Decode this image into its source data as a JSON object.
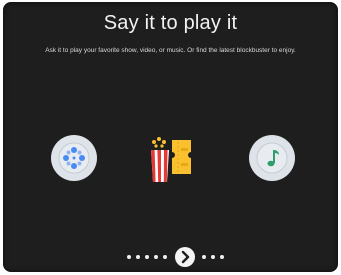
{
  "onboarding": {
    "title": "Say it to play it",
    "subtitle": "Ask it to play your favorite show, video, or music. Or find the latest blockbuster to enjoy."
  },
  "icons": [
    {
      "name": "film-reel-icon",
      "background": "#dde3e8",
      "accent": "#4a8af4"
    },
    {
      "name": "popcorn-ticket-icon",
      "accents": [
        "#e53935",
        "#fbc02d"
      ]
    },
    {
      "name": "music-note-icon",
      "background": "#dde3e8",
      "accent": "#2e9e6e"
    }
  ],
  "pager": {
    "dots_before": 5,
    "dots_after": 3,
    "next_icon": "chevron-right-icon"
  },
  "colors": {
    "background": "#1e1e1e",
    "text": "#f2f2f2"
  }
}
